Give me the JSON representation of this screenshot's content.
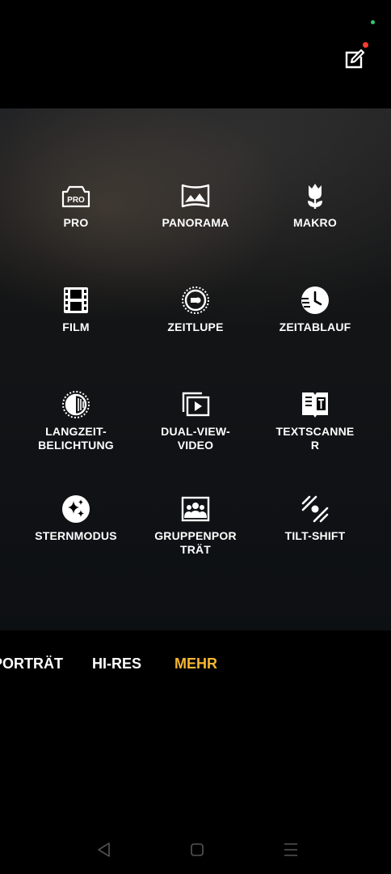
{
  "grid": [
    {
      "label": "PRO",
      "icon": "pro-icon",
      "name": "mode-pro"
    },
    {
      "label": "PANORAMA",
      "icon": "panorama-icon",
      "name": "mode-panorama"
    },
    {
      "label": "MAKRO",
      "icon": "macro-flower-icon",
      "name": "mode-makro"
    },
    {
      "label": "FILM",
      "icon": "film-icon",
      "name": "mode-film"
    },
    {
      "label": "ZEITLUPE",
      "icon": "slow-motion-icon",
      "name": "mode-zeitlupe"
    },
    {
      "label": "ZEITABLAUF",
      "icon": "timelapse-clock-icon",
      "name": "mode-zeitablauf"
    },
    {
      "label": "LANGZEIT-\nBELICHTUNG",
      "icon": "long-exposure-icon",
      "name": "mode-langzeitbelichtung"
    },
    {
      "label": "DUAL-VIEW-\nVIDEO",
      "icon": "dual-view-video-icon",
      "name": "mode-dual-view-video"
    },
    {
      "label": "TEXTSCANNE\nR",
      "icon": "text-scanner-icon",
      "name": "mode-textscanner"
    },
    {
      "label": "STERNMODUS",
      "icon": "star-mode-icon",
      "name": "mode-sternmodus"
    },
    {
      "label": "GRUPPENPOR\nTRÄT",
      "icon": "group-portrait-icon",
      "name": "mode-gruppenportraet"
    },
    {
      "label": "TILT-SHIFT",
      "icon": "tilt-shift-icon",
      "name": "mode-tilt-shift"
    }
  ],
  "modebar": {
    "portrait": "PORTRÄT",
    "hires": "HI-RES",
    "mehr": "MEHR"
  },
  "colors": {
    "accent": "#f5b731",
    "badge": "#ff3b30",
    "status": "#2ecc71"
  }
}
